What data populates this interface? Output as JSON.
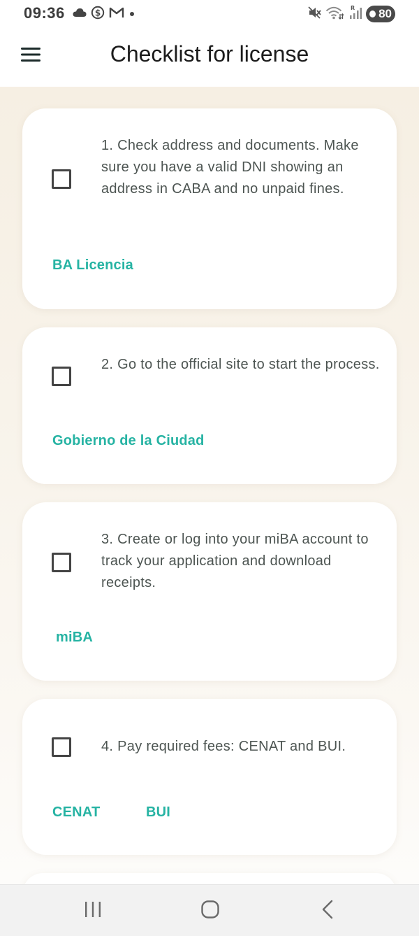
{
  "status_bar": {
    "time": "09:36",
    "battery": "80",
    "left_icons": [
      "cloud-icon",
      "dollar-coin-icon",
      "gmail-icon",
      "notification-dot-icon"
    ],
    "right_icons": [
      "mute-icon",
      "wifi-icon",
      "signal-icon",
      "battery-icon"
    ]
  },
  "app_bar": {
    "title": "Checklist for license",
    "menu_icon": "hamburger-menu-icon"
  },
  "steps": [
    {
      "text": "1. Check address and documents. Make sure you have a valid DNI showing an address in CABA and no unpaid fines.",
      "checked": false,
      "links": [
        "BA Licencia"
      ]
    },
    {
      "text": "2. Go to the official site to start the process.",
      "checked": false,
      "links": [
        "Gobierno de la Ciudad"
      ]
    },
    {
      "text": "3. Create or log into your miBA account to track your application and download receipts.",
      "checked": false,
      "links": [
        "miBA"
      ]
    },
    {
      "text": "4. Pay required fees: CENAT and BUI.",
      "checked": false,
      "links": [
        "CENAT",
        "BUI"
      ]
    }
  ],
  "nav_bar": {
    "icons": [
      "recent-apps-icon",
      "home-icon",
      "back-icon"
    ]
  },
  "colors": {
    "accent": "#26b3a3",
    "text": "#4d5552",
    "title": "#1c1c1c",
    "background": "#f6efe3",
    "card": "#ffffff"
  }
}
